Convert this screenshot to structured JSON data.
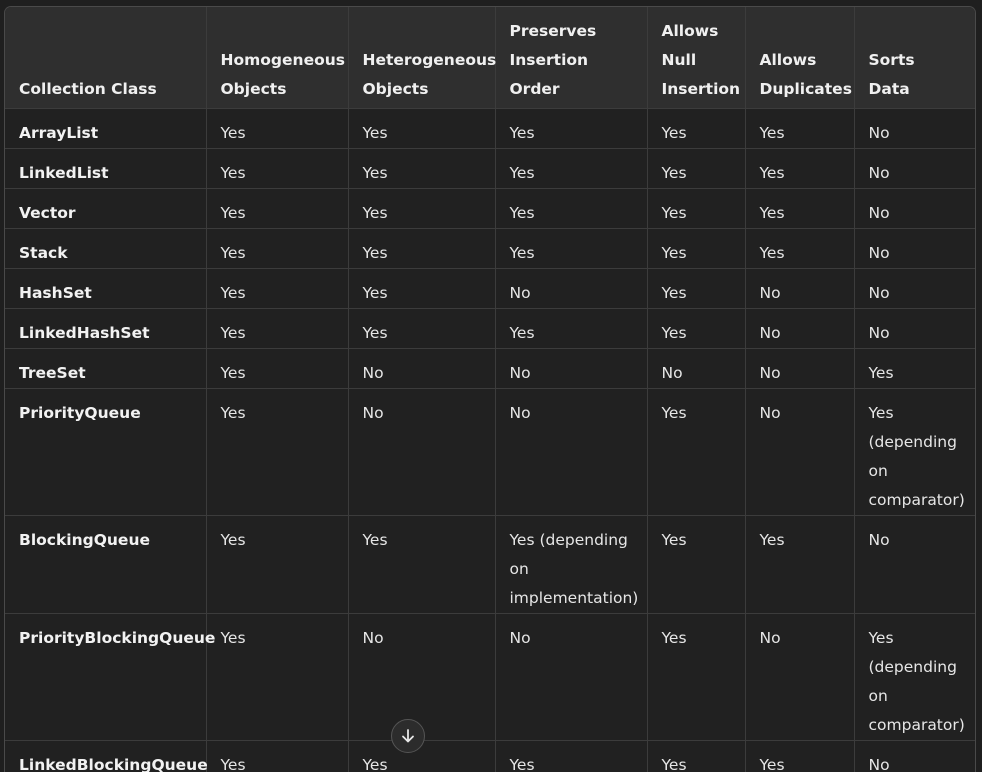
{
  "table": {
    "headers": [
      "Collection Class",
      "Homogeneous Objects",
      "Heterogeneous Objects",
      "Preserves Insertion Order",
      "Allows Null Insertion",
      "Allows Duplicates",
      "Sorts Data"
    ],
    "rows": [
      [
        "ArrayList",
        "Yes",
        "Yes",
        "Yes",
        "Yes",
        "Yes",
        "No"
      ],
      [
        "LinkedList",
        "Yes",
        "Yes",
        "Yes",
        "Yes",
        "Yes",
        "No"
      ],
      [
        "Vector",
        "Yes",
        "Yes",
        "Yes",
        "Yes",
        "Yes",
        "No"
      ],
      [
        "Stack",
        "Yes",
        "Yes",
        "Yes",
        "Yes",
        "Yes",
        "No"
      ],
      [
        "HashSet",
        "Yes",
        "Yes",
        "No",
        "Yes",
        "No",
        "No"
      ],
      [
        "LinkedHashSet",
        "Yes",
        "Yes",
        "Yes",
        "Yes",
        "No",
        "No"
      ],
      [
        "TreeSet",
        "Yes",
        "No",
        "No",
        "No",
        "No",
        "Yes"
      ],
      [
        "PriorityQueue",
        "Yes",
        "No",
        "No",
        "Yes",
        "No",
        "Yes (depending on comparator)"
      ],
      [
        "BlockingQueue",
        "Yes",
        "Yes",
        "Yes (depending on implementation)",
        "Yes",
        "Yes",
        "No"
      ],
      [
        "PriorityBlockingQueue",
        "Yes",
        "No",
        "No",
        "Yes",
        "No",
        "Yes (depending on comparator)"
      ],
      [
        "LinkedBlockingQueue",
        "Yes",
        "Yes",
        "Yes",
        "Yes",
        "Yes",
        "No"
      ]
    ]
  },
  "scroll_button": {
    "icon": "arrow-down-icon"
  }
}
